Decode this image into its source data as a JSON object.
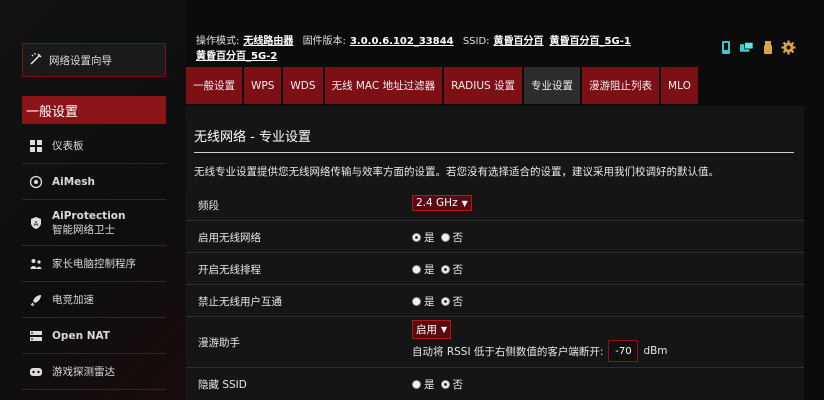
{
  "sidebar": {
    "quick_setup": "网络设置向导",
    "section_title": "一般设置",
    "items": [
      {
        "label": "仪表板",
        "icon": "dashboard-icon"
      },
      {
        "label": "AiMesh",
        "icon": "aimesh-icon"
      },
      {
        "label": "AiProtection",
        "sub": "智能网络卫士",
        "icon": "shield-icon"
      },
      {
        "label": "家长电脑控制程序",
        "icon": "parental-control-icon"
      },
      {
        "label": "电竞加速",
        "icon": "rocket-icon"
      },
      {
        "label": "Open NAT",
        "icon": "open-nat-icon"
      },
      {
        "label": "游戏探测雷达",
        "icon": "radar-icon"
      }
    ]
  },
  "header": {
    "mode_label": "操作模式:",
    "mode_value": "无线路由器",
    "firmware_label": "固件版本:",
    "firmware_value": "3.0.0.6.102_33844",
    "ssid_label": "SSID:",
    "ssids": [
      "黄昏百分百",
      "黄昏百分百_5G-1",
      "黄昏百分百_5G-2"
    ],
    "icons": [
      "network-status-icon",
      "router-icon",
      "usb-icon",
      "gear-icon"
    ]
  },
  "tabs": [
    "一般设置",
    "WPS",
    "WDS",
    "无线 MAC 地址过滤器",
    "RADIUS 设置",
    "专业设置",
    "漫游阻止列表",
    "MLO"
  ],
  "active_tab": "专业设置",
  "panel": {
    "title": "无线网络 - 专业设置",
    "description": "无线专业设置提供您无线网络传输与效率方面的设置。若您没有选择适合的设置，建议采用我们校调好的默认值。",
    "rows": {
      "band": {
        "label": "频段",
        "value": "2.4 GHz"
      },
      "enable_radio": {
        "label": "启用无线网络",
        "yes": "是",
        "no": "否",
        "selected": "yes"
      },
      "wireless_schedule": {
        "label": "开启无线排程",
        "yes": "是",
        "no": "否",
        "selected": "no"
      },
      "ap_isolation": {
        "label": "禁止无线用户互通",
        "yes": "是",
        "no": "否",
        "selected": "no"
      },
      "roaming_assistant": {
        "label": "漫游助手",
        "value": "启用",
        "rssi_text": "自动将 RSSI 低于右侧数值的客户端断开:",
        "rssi_value": "-70",
        "unit": "dBm"
      },
      "hide_ssid": {
        "label": "隐藏 SSID",
        "yes": "是",
        "no": "否",
        "selected": "no"
      }
    }
  },
  "colors": {
    "accent": "#8a1418",
    "tab": "#7d1014",
    "active_tab": "#2d2d2d",
    "background": "#0b0b0b"
  }
}
